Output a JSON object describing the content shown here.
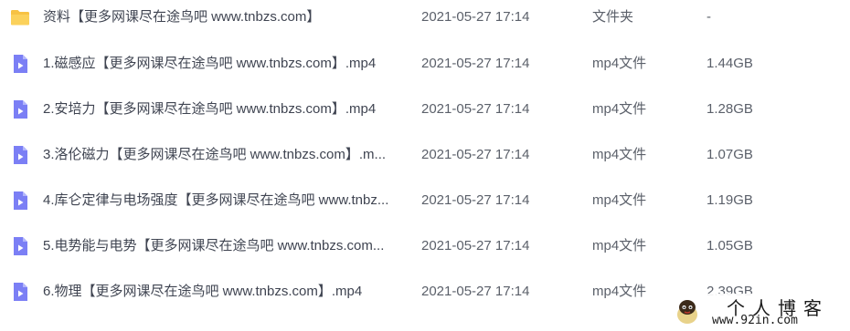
{
  "files": [
    {
      "icon": "folder-icon",
      "name": "资料【更多网课尽在途鸟吧 www.tnbzs.com】",
      "date": "2021-05-27 17:14",
      "type": "文件夹",
      "size": "-"
    },
    {
      "icon": "video-file-icon",
      "name": "1.磁感应【更多网课尽在途鸟吧 www.tnbzs.com】.mp4",
      "date": "2021-05-27 17:14",
      "type": "mp4文件",
      "size": "1.44GB"
    },
    {
      "icon": "video-file-icon",
      "name": "2.安培力【更多网课尽在途鸟吧 www.tnbzs.com】.mp4",
      "date": "2021-05-27 17:14",
      "type": "mp4文件",
      "size": "1.28GB"
    },
    {
      "icon": "video-file-icon",
      "name": "3.洛伦磁力【更多网课尽在途鸟吧 www.tnbzs.com】.m...",
      "date": "2021-05-27 17:14",
      "type": "mp4文件",
      "size": "1.07GB"
    },
    {
      "icon": "video-file-icon",
      "name": "4.库仑定律与电场强度【更多网课尽在途鸟吧 www.tnbz...",
      "date": "2021-05-27 17:14",
      "type": "mp4文件",
      "size": "1.19GB"
    },
    {
      "icon": "video-file-icon",
      "name": "5.电势能与电势【更多网课尽在途鸟吧 www.tnbzs.com...",
      "date": "2021-05-27 17:14",
      "type": "mp4文件",
      "size": "1.05GB"
    },
    {
      "icon": "video-file-icon",
      "name": "6.物理【更多网课尽在途鸟吧 www.tnbzs.com】.mp4",
      "date": "2021-05-27 17:14",
      "type": "mp4文件",
      "size": "2.39GB"
    }
  ],
  "watermark": {
    "title": "个人博客",
    "url": "www.92in.com"
  },
  "colors": {
    "folder": "#f7c244",
    "video": "#7b7ff5"
  }
}
